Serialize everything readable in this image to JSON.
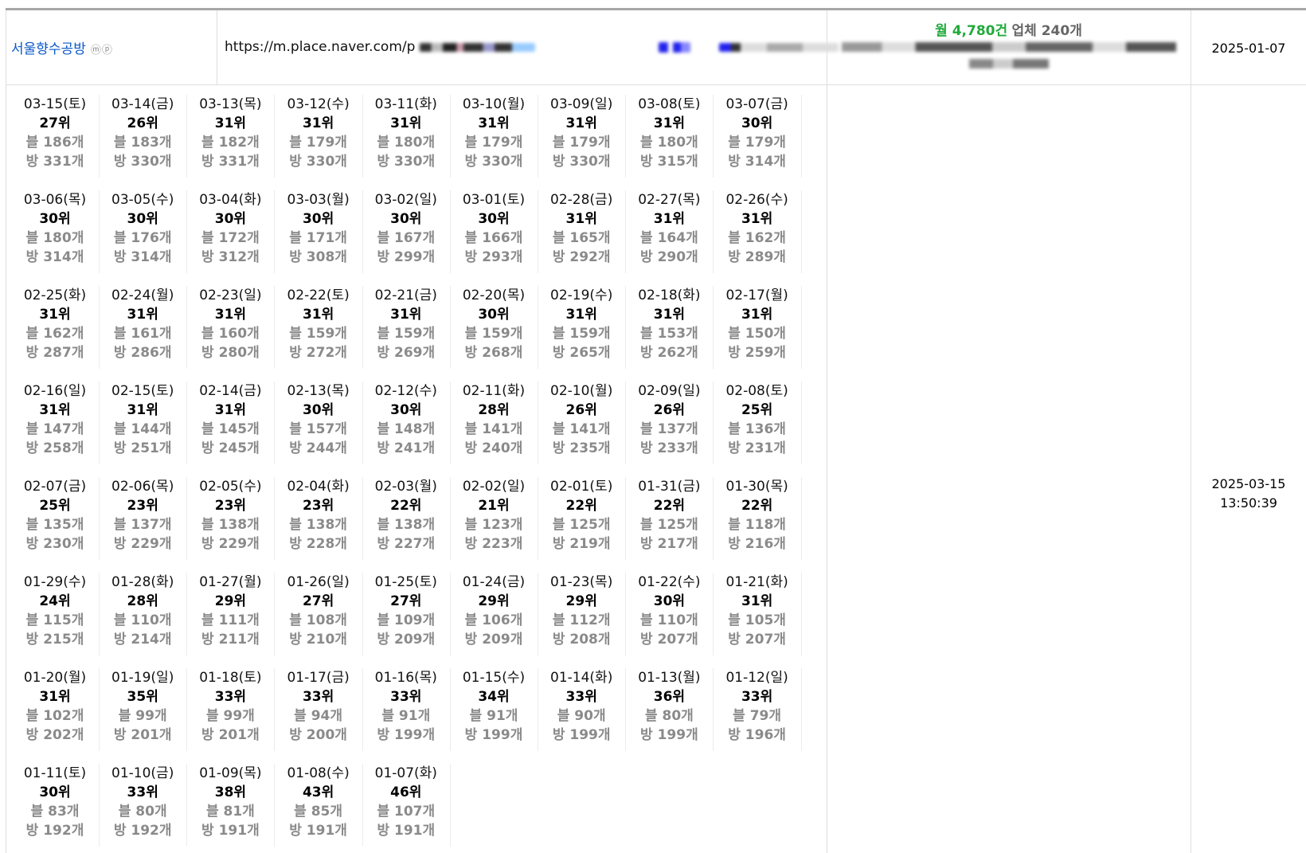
{
  "row": {
    "keyword": "서울향수공방",
    "keyword_badge": "ⓜⓟ",
    "url_prefix": "https://m.place.naver.com/p",
    "stats_month_label": "월 4,780건",
    "stats_company_label": "업체 240개",
    "registered_date": "2025-01-07",
    "updated_date": "2025-03-15",
    "updated_time": "13:50:39"
  },
  "daily": [
    {
      "date": "03-15(토)",
      "rank": "27위",
      "blog": "블 186개",
      "place": "방 331개"
    },
    {
      "date": "03-14(금)",
      "rank": "26위",
      "blog": "블 183개",
      "place": "방 330개"
    },
    {
      "date": "03-13(목)",
      "rank": "31위",
      "blog": "블 182개",
      "place": "방 331개"
    },
    {
      "date": "03-12(수)",
      "rank": "31위",
      "blog": "블 179개",
      "place": "방 330개"
    },
    {
      "date": "03-11(화)",
      "rank": "31위",
      "blog": "블 180개",
      "place": "방 330개"
    },
    {
      "date": "03-10(월)",
      "rank": "31위",
      "blog": "블 179개",
      "place": "방 330개"
    },
    {
      "date": "03-09(일)",
      "rank": "31위",
      "blog": "블 179개",
      "place": "방 330개"
    },
    {
      "date": "03-08(토)",
      "rank": "31위",
      "blog": "블 180개",
      "place": "방 315개"
    },
    {
      "date": "03-07(금)",
      "rank": "30위",
      "blog": "블 179개",
      "place": "방 314개"
    },
    {
      "date": "03-06(목)",
      "rank": "30위",
      "blog": "블 180개",
      "place": "방 314개"
    },
    {
      "date": "03-05(수)",
      "rank": "30위",
      "blog": "블 176개",
      "place": "방 314개"
    },
    {
      "date": "03-04(화)",
      "rank": "30위",
      "blog": "블 172개",
      "place": "방 312개"
    },
    {
      "date": "03-03(월)",
      "rank": "30위",
      "blog": "블 171개",
      "place": "방 308개"
    },
    {
      "date": "03-02(일)",
      "rank": "30위",
      "blog": "블 167개",
      "place": "방 299개"
    },
    {
      "date": "03-01(토)",
      "rank": "30위",
      "blog": "블 166개",
      "place": "방 293개"
    },
    {
      "date": "02-28(금)",
      "rank": "31위",
      "blog": "블 165개",
      "place": "방 292개"
    },
    {
      "date": "02-27(목)",
      "rank": "31위",
      "blog": "블 164개",
      "place": "방 290개"
    },
    {
      "date": "02-26(수)",
      "rank": "31위",
      "blog": "블 162개",
      "place": "방 289개"
    },
    {
      "date": "02-25(화)",
      "rank": "31위",
      "blog": "블 162개",
      "place": "방 287개"
    },
    {
      "date": "02-24(월)",
      "rank": "31위",
      "blog": "블 161개",
      "place": "방 286개"
    },
    {
      "date": "02-23(일)",
      "rank": "31위",
      "blog": "블 160개",
      "place": "방 280개"
    },
    {
      "date": "02-22(토)",
      "rank": "31위",
      "blog": "블 159개",
      "place": "방 272개"
    },
    {
      "date": "02-21(금)",
      "rank": "31위",
      "blog": "블 159개",
      "place": "방 269개"
    },
    {
      "date": "02-20(목)",
      "rank": "30위",
      "blog": "블 159개",
      "place": "방 268개"
    },
    {
      "date": "02-19(수)",
      "rank": "31위",
      "blog": "블 159개",
      "place": "방 265개"
    },
    {
      "date": "02-18(화)",
      "rank": "31위",
      "blog": "블 153개",
      "place": "방 262개"
    },
    {
      "date": "02-17(월)",
      "rank": "31위",
      "blog": "블 150개",
      "place": "방 259개"
    },
    {
      "date": "02-16(일)",
      "rank": "31위",
      "blog": "블 147개",
      "place": "방 258개"
    },
    {
      "date": "02-15(토)",
      "rank": "31위",
      "blog": "블 144개",
      "place": "방 251개"
    },
    {
      "date": "02-14(금)",
      "rank": "31위",
      "blog": "블 145개",
      "place": "방 245개"
    },
    {
      "date": "02-13(목)",
      "rank": "30위",
      "blog": "블 157개",
      "place": "방 244개"
    },
    {
      "date": "02-12(수)",
      "rank": "30위",
      "blog": "블 148개",
      "place": "방 241개"
    },
    {
      "date": "02-11(화)",
      "rank": "28위",
      "blog": "블 141개",
      "place": "방 240개"
    },
    {
      "date": "02-10(월)",
      "rank": "26위",
      "blog": "블 141개",
      "place": "방 235개"
    },
    {
      "date": "02-09(일)",
      "rank": "26위",
      "blog": "블 137개",
      "place": "방 233개"
    },
    {
      "date": "02-08(토)",
      "rank": "25위",
      "blog": "블 136개",
      "place": "방 231개"
    },
    {
      "date": "02-07(금)",
      "rank": "25위",
      "blog": "블 135개",
      "place": "방 230개"
    },
    {
      "date": "02-06(목)",
      "rank": "23위",
      "blog": "블 137개",
      "place": "방 229개"
    },
    {
      "date": "02-05(수)",
      "rank": "23위",
      "blog": "블 138개",
      "place": "방 229개"
    },
    {
      "date": "02-04(화)",
      "rank": "23위",
      "blog": "블 138개",
      "place": "방 228개"
    },
    {
      "date": "02-03(월)",
      "rank": "22위",
      "blog": "블 138개",
      "place": "방 227개"
    },
    {
      "date": "02-02(일)",
      "rank": "21위",
      "blog": "블 123개",
      "place": "방 223개"
    },
    {
      "date": "02-01(토)",
      "rank": "22위",
      "blog": "블 125개",
      "place": "방 219개"
    },
    {
      "date": "01-31(금)",
      "rank": "22위",
      "blog": "블 125개",
      "place": "방 217개"
    },
    {
      "date": "01-30(목)",
      "rank": "22위",
      "blog": "블 118개",
      "place": "방 216개"
    },
    {
      "date": "01-29(수)",
      "rank": "24위",
      "blog": "블 115개",
      "place": "방 215개"
    },
    {
      "date": "01-28(화)",
      "rank": "28위",
      "blog": "블 110개",
      "place": "방 214개"
    },
    {
      "date": "01-27(월)",
      "rank": "29위",
      "blog": "블 111개",
      "place": "방 211개"
    },
    {
      "date": "01-26(일)",
      "rank": "27위",
      "blog": "블 108개",
      "place": "방 210개"
    },
    {
      "date": "01-25(토)",
      "rank": "27위",
      "blog": "블 109개",
      "place": "방 209개"
    },
    {
      "date": "01-24(금)",
      "rank": "29위",
      "blog": "블 106개",
      "place": "방 209개"
    },
    {
      "date": "01-23(목)",
      "rank": "29위",
      "blog": "블 112개",
      "place": "방 208개"
    },
    {
      "date": "01-22(수)",
      "rank": "30위",
      "blog": "블 110개",
      "place": "방 207개"
    },
    {
      "date": "01-21(화)",
      "rank": "31위",
      "blog": "블 105개",
      "place": "방 207개"
    },
    {
      "date": "01-20(월)",
      "rank": "31위",
      "blog": "블 102개",
      "place": "방 202개"
    },
    {
      "date": "01-19(일)",
      "rank": "35위",
      "blog": "블 99개",
      "place": "방 201개"
    },
    {
      "date": "01-18(토)",
      "rank": "33위",
      "blog": "블 99개",
      "place": "방 201개"
    },
    {
      "date": "01-17(금)",
      "rank": "33위",
      "blog": "블 94개",
      "place": "방 200개"
    },
    {
      "date": "01-16(목)",
      "rank": "33위",
      "blog": "블 91개",
      "place": "방 199개"
    },
    {
      "date": "01-15(수)",
      "rank": "34위",
      "blog": "블 91개",
      "place": "방 199개"
    },
    {
      "date": "01-14(화)",
      "rank": "33위",
      "blog": "블 90개",
      "place": "방 199개"
    },
    {
      "date": "01-13(월)",
      "rank": "36위",
      "blog": "블 80개",
      "place": "방 199개"
    },
    {
      "date": "01-12(일)",
      "rank": "33위",
      "blog": "블 79개",
      "place": "방 196개"
    },
    {
      "date": "01-11(토)",
      "rank": "30위",
      "blog": "블 83개",
      "place": "방 192개"
    },
    {
      "date": "01-10(금)",
      "rank": "33위",
      "blog": "블 80개",
      "place": "방 192개"
    },
    {
      "date": "01-09(목)",
      "rank": "38위",
      "blog": "블 81개",
      "place": "방 191개"
    },
    {
      "date": "01-08(수)",
      "rank": "43위",
      "blog": "블 85개",
      "place": "방 191개"
    },
    {
      "date": "01-07(화)",
      "rank": "46위",
      "blog": "블 107개",
      "place": "방 191개"
    }
  ]
}
